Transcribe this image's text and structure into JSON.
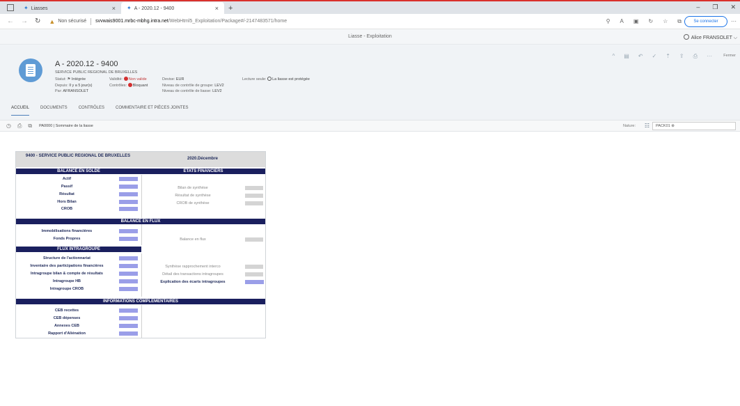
{
  "browser": {
    "tabs": [
      {
        "label": "Liasses",
        "active": false
      },
      {
        "label": "A - 2020.12 - 9400",
        "active": true
      }
    ],
    "new_tab": "+",
    "window_controls": [
      "–",
      "❐",
      "✕"
    ],
    "not_secure_label": "Non sécurisé",
    "url_host": "svvwais9001.mrbc-mbhg.intra.net",
    "url_path": "/WebHtml5_Exploitation/Package#/-2147483571/home",
    "connect_label": "Se connecter",
    "more": "···"
  },
  "app": {
    "title": "Liasse - Exploitation",
    "user": "Alice FRANSOLET ⌵"
  },
  "header": {
    "title": "A - 2020.12 - 9400",
    "subtitle": "SERVICE PUBLIC REGIONAL DE BRUXELLES",
    "statut_label": "Statut:",
    "statut_value": "Intégrée",
    "depuis_label": "Depuis:",
    "depuis_value": "Il y a 5 jour(s)",
    "par_label": "Par:",
    "par_value": "AFRANSOLET",
    "validite_label": "Validité:",
    "validite_value": "Non valide",
    "controles_label": "Contrôles:",
    "controles_value": "Bloquant",
    "devise_label": "Devise:",
    "devise_value": "EUR",
    "niveau_groupe_label": "Niveau de contrôle de groupe:",
    "niveau_groupe_value": "LEV2",
    "niveau_liasse_label": "Niveau de contrôle de liasse:",
    "niveau_liasse_value": "LEV2",
    "lecture_label": "Lecture seule:",
    "lecture_value": "La liasse est protégée",
    "fermer": "Fermer",
    "tabs": [
      "ACCUEIL",
      "DOCUMENTS",
      "CONTRÔLES",
      "COMMENTAIRE ET PIÈCES JOINTES"
    ]
  },
  "subbar": {
    "crumb": "PA0000 | Sommaire de la liasse",
    "nature_label": "Nature:",
    "pack_value": "PACK01 ⊗"
  },
  "report": {
    "entity": "9400 - SERVICE PUBLIC REGIONAL DE BRUXELLES",
    "period": "2020.Décembre",
    "balance_solde": "BALANCE EN SOLDE",
    "etats_financiers": "ETATS FINANCIERS",
    "left_solde": [
      "Actif",
      "Passif",
      "Résultat",
      "Hors Bilan",
      "CROB"
    ],
    "right_solde": [
      "Bilan de synthèse",
      "Résultat de synthèse",
      "CROB de synthèse"
    ],
    "balance_flux": "BALANCE EN FLUX",
    "left_flux": [
      "Immobilisations financières",
      "Fonds Propres"
    ],
    "right_flux": [
      "Balance en flux"
    ],
    "flux_intragroupe": "FLUX INTRAGROUPE",
    "left_intra": [
      "Structure de l'actionnariat",
      "Inventaire des participations financières",
      "Intragroupe bilan & compte de résultats",
      "Intragroupe HB",
      "Intragroupe CROB"
    ],
    "right_intra": [
      "Synthèse rapprochement interco",
      "Détail des transactions intragroupes",
      "Explication des écarts intragroupes"
    ],
    "infos": "INFORMATIONS COMPLEMENTAIRES",
    "left_infos": [
      "CEB recettes",
      "CEB dépenses",
      "Annexes CEB",
      "Rapport d'Aliénation"
    ]
  }
}
